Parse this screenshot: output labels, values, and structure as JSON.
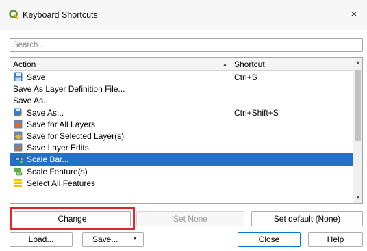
{
  "window": {
    "title": "Keyboard Shortcuts",
    "close_glyph": "×",
    "icon": "qgis-logo-icon"
  },
  "search": {
    "placeholder": "Search...",
    "value": ""
  },
  "table": {
    "columns": [
      "Action",
      "Shortcut"
    ],
    "sorted_by": "Action",
    "rows": [
      {
        "icon": "save-icon",
        "label": "Save",
        "shortcut": "Ctrl+S"
      },
      {
        "icon": "",
        "label": "Save As Layer Definition File...",
        "shortcut": ""
      },
      {
        "icon": "",
        "label": "Save As...",
        "shortcut": ""
      },
      {
        "icon": "save-as-icon",
        "label": "Save As...",
        "shortcut": "Ctrl+Shift+S"
      },
      {
        "icon": "save-all-layers-icon",
        "label": "Save for All Layers",
        "shortcut": ""
      },
      {
        "icon": "save-selected-layers-icon",
        "label": "Save for Selected Layer(s)",
        "shortcut": ""
      },
      {
        "icon": "save-layer-edits-icon",
        "label": "Save Layer Edits",
        "shortcut": ""
      },
      {
        "icon": "scale-bar-icon",
        "label": "Scale Bar...",
        "shortcut": "",
        "selected": true
      },
      {
        "icon": "scale-feature-icon",
        "label": "Scale Feature(s)",
        "shortcut": ""
      },
      {
        "icon": "select-all-icon",
        "label": "Select All Features",
        "shortcut": ""
      }
    ]
  },
  "buttons": {
    "change": "Change",
    "set_none": "Set None",
    "set_default": "Set default (None)",
    "load": "Load...",
    "save": "Save...",
    "close": "Close",
    "help": "Help"
  },
  "colors": {
    "selection": "#2470c6",
    "highlight_box": "#e3242b",
    "qgis_green": "#589632"
  }
}
